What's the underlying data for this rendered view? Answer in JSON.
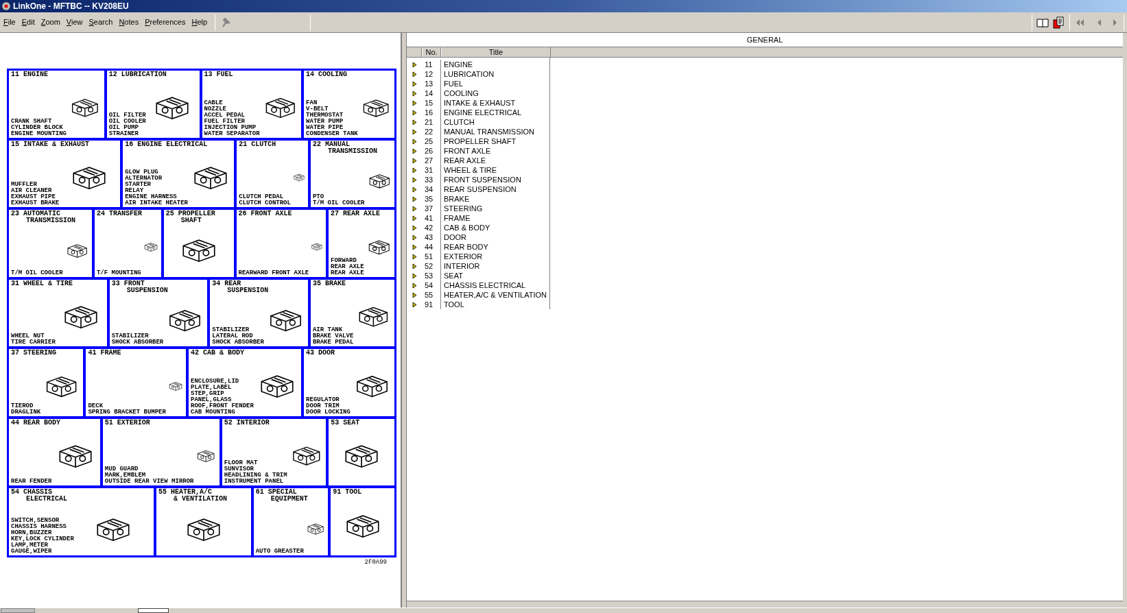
{
  "window": {
    "title": "LinkOne - MFTBC -- KV208EU"
  },
  "menu": [
    "File",
    "Edit",
    "Zoom",
    "View",
    "Search",
    "Notes",
    "Preferences",
    "Help"
  ],
  "diagram": {
    "rows": [
      [
        {
          "title": [
            "11 ENGINE"
          ],
          "parts": [
            "CRANK SHAFT",
            "CYLINDER BLOCK",
            "ENGINE MOUNTING"
          ]
        },
        {
          "title": [
            "12 LUBRICATION"
          ],
          "parts": [
            "OIL FILTER",
            "OIL COOLER",
            "OIL PUMP",
            "STRAINER"
          ]
        },
        {
          "title": [
            "13 FUEL"
          ],
          "parts": [
            "CABLE",
            "NOZZLE",
            "ACCEL PEDAL",
            "FUEL FILTER",
            "INJECTION PUMP",
            "WATER SEPARATOR"
          ]
        },
        {
          "title": [
            "14 COOLING"
          ],
          "parts": [
            "FAN",
            "V-BELT",
            "THERMOSTAT",
            "WATER PUMP",
            "WATER PIPE",
            "CONDENSER TANK"
          ]
        }
      ],
      [
        {
          "title": [
            "15 INTAKE & EXHAUST"
          ],
          "parts": [
            "MUFFLER",
            "AIR CLEANER",
            "EXHAUST PIPE",
            "EXHAUST BRAKE"
          ]
        },
        {
          "title": [
            "16 ENGINE ELECTRICAL"
          ],
          "parts": [
            "GLOW PLUG",
            "ALTERNATOR",
            "STARTER",
            "RELAY",
            "ENGINE HARNESS",
            "AIR INTAKE HEATER"
          ]
        },
        {
          "title": [
            "21 CLUTCH"
          ],
          "parts": [
            "CLUTCH PEDAL",
            "CLUTCH CONTROL"
          ]
        },
        {
          "title": [
            "22 MANUAL",
            "TRANSMISSION"
          ],
          "parts": [
            "PTO",
            "T/M OIL COOLER"
          ]
        }
      ],
      [
        {
          "title": [
            "23 AUTOMATIC",
            "TRANSMISSION"
          ],
          "parts": [
            "T/M OIL COOLER"
          ]
        },
        {
          "title": [
            "24 TRANSFER"
          ],
          "parts": [
            "T/F MOUNTING"
          ]
        },
        {
          "title": [
            "25 PROPELLER",
            "SHAFT"
          ]
        },
        {
          "title": [
            "26 FRONT AXLE"
          ],
          "parts": [
            "REARWARD FRONT AXLE"
          ]
        },
        {
          "title": [
            "27 REAR AXLE"
          ],
          "parts": [
            "FORWARD",
            "REAR AXLE",
            "REAR AXLE"
          ]
        }
      ],
      [
        {
          "title": [
            "31 WHEEL & TIRE"
          ],
          "parts": [
            "WHEEL NUT",
            "TIRE CARRIER"
          ]
        },
        {
          "title": [
            "33 FRONT",
            "SUSPENSION"
          ],
          "parts": [
            "STABILIZER",
            "SHOCK ABSORBER"
          ]
        },
        {
          "title": [
            "34 REAR",
            "SUSPENSION"
          ],
          "parts": [
            "STABILIZER",
            "LATERAL ROD",
            "SHOCK ABSORBER"
          ]
        },
        {
          "title": [
            "35 BRAKE"
          ],
          "parts": [
            "AIR TANK",
            "BRAKE VALVE",
            "BRAKE PEDAL"
          ]
        }
      ],
      [
        {
          "title": [
            "37 STEERING"
          ],
          "parts": [
            "TIEROD",
            "DRAGLINK"
          ]
        },
        {
          "title": [
            "41 FRAME"
          ],
          "parts": [
            "DECK",
            "SPRING BRACKET BUMPER"
          ]
        },
        {
          "title": [
            "42 CAB & BODY"
          ],
          "parts": [
            "ENCLOSURE,LID",
            "PLATE,LABEL",
            "STEP,GRIP",
            "PANEL,GLASS",
            "ROOF,FRONT FENDER",
            "CAB MOUNTING"
          ]
        },
        {
          "title": [
            "43 DOOR"
          ],
          "parts": [
            "REGULATOR",
            "DOOR TRIM",
            "DOOR LOCKING"
          ]
        }
      ],
      [
        {
          "title": [
            "44 REAR BODY"
          ],
          "parts": [
            "REAR FENDER"
          ]
        },
        {
          "title": [
            "51 EXTERIOR"
          ],
          "parts": [
            "MUD GUARD",
            "MARK,EMBLEM",
            "OUTSIDE REAR VIEW MIRROR"
          ]
        },
        {
          "title": [
            "52 INTERIOR"
          ],
          "parts": [
            "FLOOR MAT",
            "SUNVISOR",
            "HEADLINING & TRIM",
            "INSTRUMENT PANEL"
          ]
        },
        {
          "title": [
            "53 SEAT"
          ]
        }
      ],
      [
        {
          "title": [
            "54 CHASSIS",
            "ELECTRICAL"
          ],
          "parts": [
            "SWITCH,SENSOR",
            "CHASSIS HARNESS",
            "HORN,BUZZER",
            "KEY,LOCK CYLINDER",
            "LAMP,METER",
            "GAUGE,WIPER"
          ]
        },
        {
          "title": [
            "55 HEATER,A/C",
            "& VENTILATION"
          ]
        },
        {
          "title": [
            "61 SPECIAL",
            "EQUIPMENT"
          ],
          "parts": [
            "AUTO GREASTER"
          ]
        },
        {
          "title": [
            "91 TOOL"
          ]
        }
      ]
    ],
    "code": "2F0A99"
  },
  "panel": {
    "title": "GENERAL",
    "columns": [
      "No.",
      "Title"
    ],
    "rows": [
      {
        "no": "11",
        "title": "ENGINE",
        "expanded": false
      },
      {
        "no": "12",
        "title": "LUBRICATION",
        "expanded": false
      },
      {
        "no": "13",
        "title": "FUEL",
        "expanded": false
      },
      {
        "no": "14",
        "title": "COOLING",
        "expanded": false
      },
      {
        "no": "15",
        "title": "INTAKE & EXHAUST",
        "expanded": false
      },
      {
        "no": "16",
        "title": "ENGINE ELECTRICAL",
        "expanded": false
      },
      {
        "no": "21",
        "title": "CLUTCH",
        "expanded": false
      },
      {
        "no": "22",
        "title": "MANUAL TRANSMISSION",
        "expanded": false
      },
      {
        "no": "25",
        "title": "PROPELLER SHAFT",
        "expanded": false
      },
      {
        "no": "26",
        "title": "FRONT AXLE",
        "expanded": false
      },
      {
        "no": "27",
        "title": "REAR AXLE",
        "expanded": false
      },
      {
        "no": "31",
        "title": "WHEEL & TIRE",
        "expanded": false
      },
      {
        "no": "33",
        "title": "FRONT SUSPENSION",
        "expanded": false
      },
      {
        "no": "34",
        "title": "REAR SUSPENSION",
        "expanded": false
      },
      {
        "no": "35",
        "title": "BRAKE",
        "expanded": false
      },
      {
        "no": "37",
        "title": "STEERING",
        "expanded": false
      },
      {
        "no": "41",
        "title": "FRAME",
        "expanded": false
      },
      {
        "no": "42",
        "title": "CAB & BODY",
        "expanded": false
      },
      {
        "no": "43",
        "title": "DOOR",
        "expanded": false
      },
      {
        "no": "44",
        "title": "REAR BODY",
        "expanded": false
      },
      {
        "no": "51",
        "title": "EXTERIOR",
        "expanded": false
      },
      {
        "no": "52",
        "title": "INTERIOR",
        "expanded": false
      },
      {
        "no": "53",
        "title": "SEAT",
        "expanded": false
      },
      {
        "no": "54",
        "title": "CHASSIS ELECTRICAL",
        "expanded": false
      },
      {
        "no": "55",
        "title": "HEATER,A/C & VENTILATION",
        "expanded": false
      },
      {
        "no": "91",
        "title": "TOOL",
        "expanded": false
      }
    ]
  }
}
